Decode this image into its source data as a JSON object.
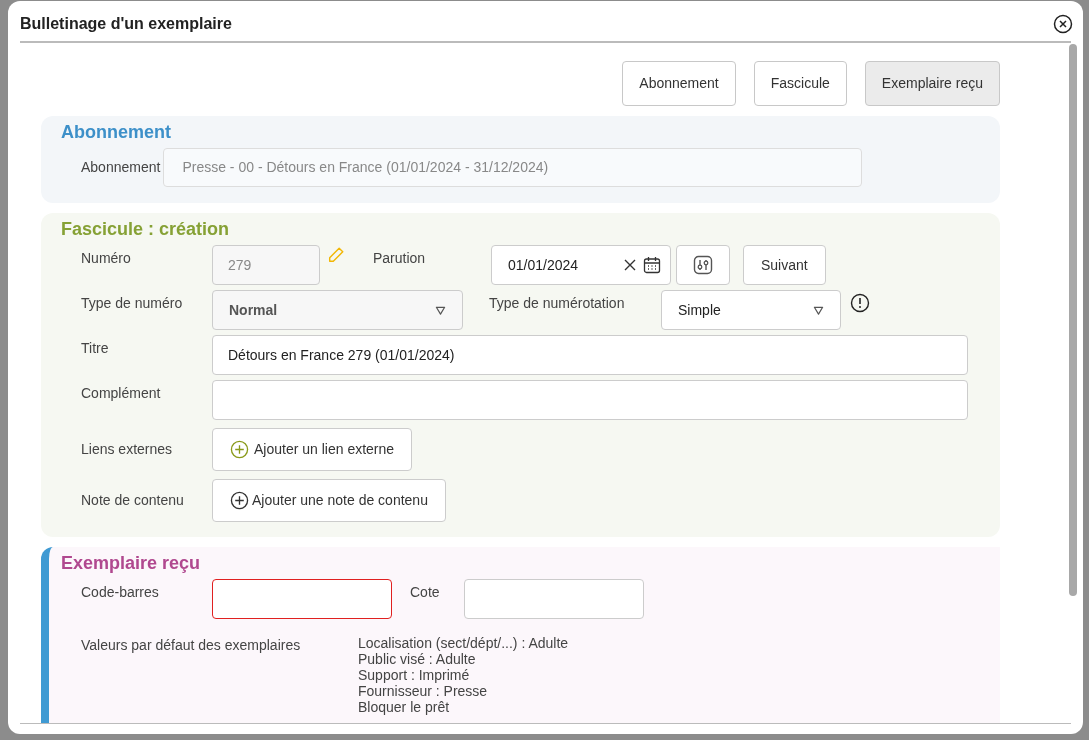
{
  "window": {
    "title": "Bulletinage d'un exemplaire"
  },
  "top_buttons": [
    {
      "label": "Abonnement",
      "selected": false
    },
    {
      "label": "Fascicule",
      "selected": false
    },
    {
      "label": "Exemplaire reçu",
      "selected": true
    }
  ],
  "abonnement": {
    "title": "Abonnement",
    "label": "Abonnement",
    "value": "Presse - 00 - Détours en France (01/01/2024 - 31/12/2024)",
    "disabled": true
  },
  "fascicule": {
    "title": "Fascicule : création",
    "numero": {
      "label": "Numéro",
      "value": "279",
      "disabled": true
    },
    "parution": {
      "label": "Parution",
      "value": "01/01/2024",
      "next_button": "Suivant"
    },
    "type_numero": {
      "label": "Type de numéro",
      "value": "Normal",
      "disabled": true
    },
    "type_numerotation": {
      "label": "Type de numérotation",
      "value": "Simple",
      "disabled": false
    },
    "titre": {
      "label": "Titre",
      "value": "Détours en France 279 (01/01/2024)"
    },
    "complement": {
      "label": "Complément"
    },
    "liens": {
      "label": "Liens externes",
      "button": "Ajouter un lien externe"
    },
    "note": {
      "label": "Note de contenu",
      "button": "Ajouter une note de contenu"
    }
  },
  "exemplaire": {
    "title": "Exemplaire reçu",
    "code_barres": {
      "label": "Code-barres",
      "error": true
    },
    "cote": {
      "label": "Cote",
      "error": false
    },
    "defaults_label": "Valeurs par défaut des exemplaires",
    "defaults": [
      "Localisation (sect/dépt/...) : Adulte",
      "Public visé : Adulte",
      "Support : Imprimé",
      "Fournisseur : Presse",
      "Bloquer le prêt"
    ]
  }
}
